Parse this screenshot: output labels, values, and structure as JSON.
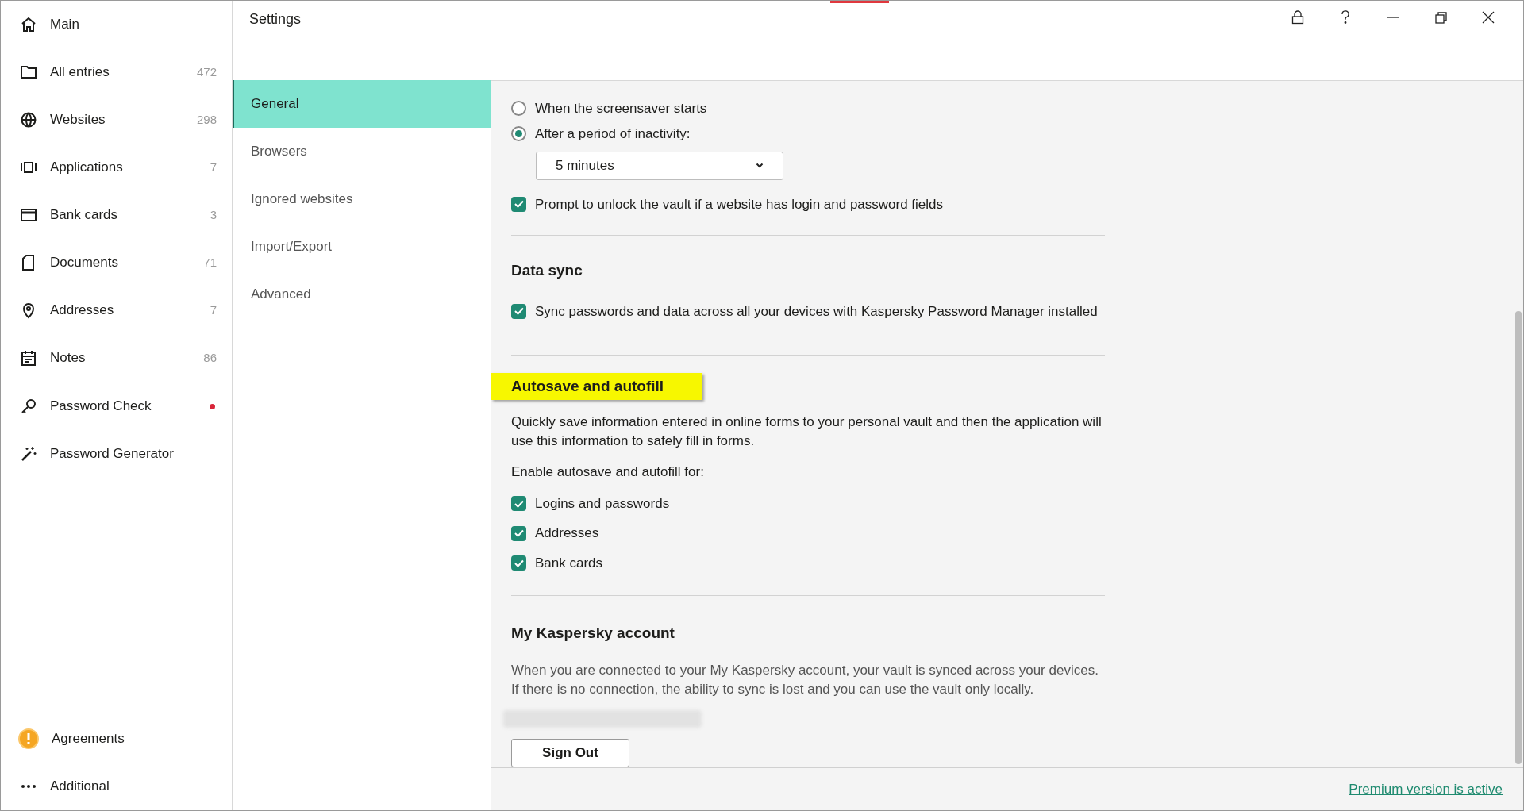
{
  "window": {
    "title": "Settings"
  },
  "sidebar": {
    "items": [
      {
        "label": "Main"
      },
      {
        "label": "All entries",
        "count": "472"
      },
      {
        "label": "Websites",
        "count": "298"
      },
      {
        "label": "Applications",
        "count": "7"
      },
      {
        "label": "Bank cards",
        "count": "3"
      },
      {
        "label": "Documents",
        "count": "71"
      },
      {
        "label": "Addresses",
        "count": "7"
      },
      {
        "label": "Notes",
        "count": "86"
      }
    ],
    "tools": [
      {
        "label": "Password Check",
        "alert": true
      },
      {
        "label": "Password Generator",
        "alert": false
      }
    ],
    "bottom": [
      {
        "label": "Agreements"
      },
      {
        "label": "Additional"
      }
    ]
  },
  "settings_nav": [
    {
      "label": "General",
      "selected": true
    },
    {
      "label": "Browsers",
      "selected": false
    },
    {
      "label": "Ignored websites",
      "selected": false
    },
    {
      "label": "Import/Export",
      "selected": false
    },
    {
      "label": "Advanced",
      "selected": false
    }
  ],
  "lock": {
    "options": [
      {
        "label": "When the screensaver starts",
        "selected": false
      },
      {
        "label": "After a period of inactivity:",
        "selected": true
      }
    ],
    "dropdown": {
      "value": "5 minutes"
    },
    "prompt": {
      "label": "Prompt to unlock the vault if a website has login and password fields",
      "checked": true
    }
  },
  "data_sync": {
    "title": "Data sync",
    "option": {
      "label": "Sync passwords and data across all your devices with Kaspersky Password Manager installed",
      "checked": true
    }
  },
  "autosave": {
    "title": "Autosave and autofill",
    "highlighted": true,
    "description": "Quickly save information entered in online forms to your personal vault and then the application will use this information to safely fill in forms.",
    "enable_label": "Enable autosave and autofill for:",
    "options": [
      {
        "label": "Logins and passwords",
        "checked": true
      },
      {
        "label": "Addresses",
        "checked": true
      },
      {
        "label": "Bank cards",
        "checked": true
      }
    ]
  },
  "account": {
    "title": "My Kaspersky account",
    "description": "When you are connected to your My Kaspersky account, your vault is synced across your devices. If there is no connection, the ability to sync is lost and you can use the vault only locally.",
    "button": "Sign Out"
  },
  "footer_link": "Premium version is active"
}
